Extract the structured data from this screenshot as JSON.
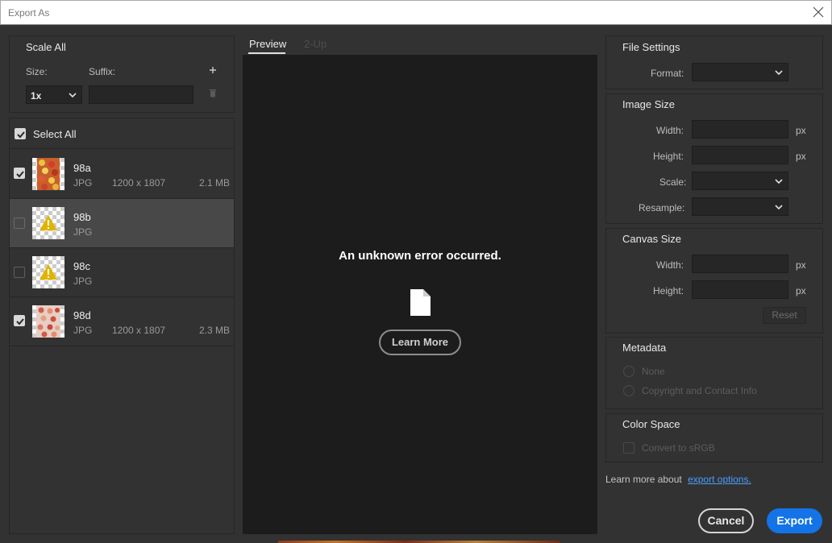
{
  "window": {
    "title": "Export As"
  },
  "scale_panel": {
    "heading": "Scale All",
    "size_label": "Size:",
    "suffix_label": "Suffix:",
    "size_value": "1x",
    "suffix_value": "",
    "add_icon": "plus-icon",
    "delete_icon": "trash-icon"
  },
  "assets": {
    "select_all_label": "Select All",
    "select_all_checked": true,
    "items": [
      {
        "name": "98a",
        "type": "JPG",
        "dimensions": "1200 x 1807",
        "size": "2.1 MB",
        "checked": true,
        "thumb": "image"
      },
      {
        "name": "98b",
        "type": "JPG",
        "dimensions": "",
        "size": "",
        "checked": false,
        "thumb": "warning"
      },
      {
        "name": "98c",
        "type": "JPG",
        "dimensions": "",
        "size": "",
        "checked": false,
        "thumb": "warning"
      },
      {
        "name": "98d",
        "type": "JPG",
        "dimensions": "1200 x 1807",
        "size": "2.3 MB",
        "checked": true,
        "thumb": "image"
      }
    ]
  },
  "preview": {
    "tabs": [
      {
        "label": "Preview",
        "active": true
      },
      {
        "label": "2-Up",
        "active": false
      }
    ],
    "error_message": "An unknown error occurred.",
    "learn_more_label": "Learn More",
    "icon": "document-icon"
  },
  "file_settings": {
    "heading": "File Settings",
    "format_label": "Format:",
    "format_value": ""
  },
  "image_size": {
    "heading": "Image Size",
    "width_label": "Width:",
    "width_value": "",
    "width_unit": "px",
    "height_label": "Height:",
    "height_value": "",
    "height_unit": "px",
    "scale_label": "Scale:",
    "scale_value": "",
    "resample_label": "Resample:",
    "resample_value": ""
  },
  "canvas_size": {
    "heading": "Canvas Size",
    "width_label": "Width:",
    "width_value": "",
    "width_unit": "px",
    "height_label": "Height:",
    "height_value": "",
    "height_unit": "px",
    "reset_label": "Reset"
  },
  "metadata": {
    "heading": "Metadata",
    "options": [
      "None",
      "Copyright and Contact Info"
    ]
  },
  "color_space": {
    "heading": "Color Space",
    "convert_label": "Convert to sRGB"
  },
  "footer": {
    "learn_text": "Learn more about",
    "learn_link": "export options.",
    "cancel_label": "Cancel",
    "export_label": "Export"
  },
  "colors": {
    "accent": "#1473e6",
    "link": "#4a9eff",
    "warning": "#e0b400"
  }
}
